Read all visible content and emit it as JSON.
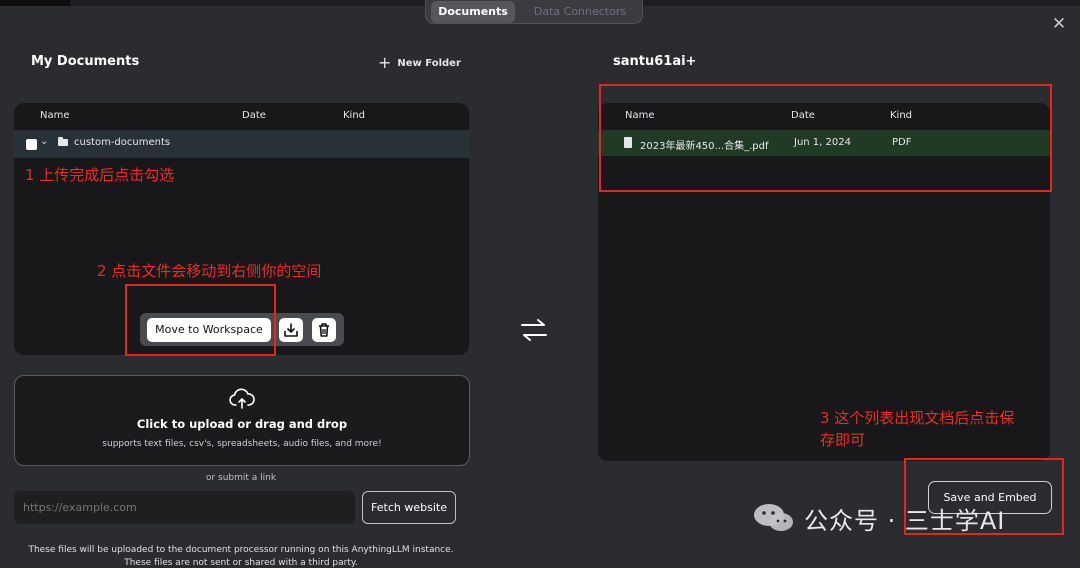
{
  "tabs": [
    {
      "label": "Documents",
      "active": true
    },
    {
      "label": "Data Connectors",
      "active": false
    }
  ],
  "left": {
    "title": "My Documents",
    "new_folder_label": "New Folder",
    "columns": [
      "Name",
      "Date",
      "Kind"
    ],
    "folder": {
      "name": "custom-documents",
      "checked": true
    },
    "move_button_label": "Move to Workspace",
    "upload": {
      "title": "Click to upload or drag and drop",
      "subtitle": "supports text files, csv's, spreadsheets, audio files, and more!"
    },
    "or_submit_link": "or submit a link",
    "link_input": {
      "placeholder": "https://example.com",
      "value": ""
    },
    "fetch_button_label": "Fetch website",
    "footnote": "These files will be uploaded to the document processor running on this AnythingLLM instance.",
    "footnote2": "These files are not sent or shared with a third party."
  },
  "right": {
    "title": "santu61ai+",
    "columns": [
      "Name",
      "Date",
      "Kind"
    ],
    "files": [
      {
        "name": "2023年最新450...合集_.pdf",
        "date": "Jun 1, 2024",
        "kind": "PDF"
      }
    ],
    "save_button_label": "Save and Embed"
  },
  "annotations": {
    "note1": "1 上传完成后点击勾选",
    "note2": "2 点击文件会移动到右侧你的空间",
    "note3_line1": "3 这个列表出现文档后点击保",
    "note3_line2": "存即可"
  },
  "watermark": {
    "text": "公众号 · 三士学AI"
  },
  "colors": {
    "background": "#2b2c30",
    "panel": "#18181b",
    "selected_file_row": "#1f3a25",
    "annotation_red": "#e3261f"
  },
  "icons": [
    "close-icon",
    "plus-icon",
    "chevron-down-icon",
    "folder-icon",
    "download-icon",
    "trash-icon",
    "cloud-upload-icon",
    "swap-arrows-icon",
    "file-icon",
    "wechat-logo"
  ]
}
